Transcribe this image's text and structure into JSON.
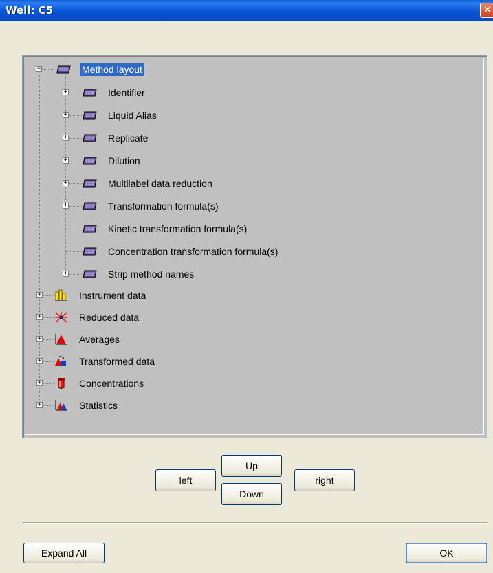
{
  "window": {
    "title": "Well: C5",
    "close_glyph": "✕"
  },
  "tree": {
    "root": {
      "label": "Method layout",
      "icon": "plate-icon"
    },
    "children": [
      {
        "label": "Identifier",
        "expandable": true
      },
      {
        "label": "Liquid Alias",
        "expandable": true
      },
      {
        "label": "Replicate",
        "expandable": true
      },
      {
        "label": "Dilution",
        "expandable": true
      },
      {
        "label": "Multilabel data reduction",
        "expandable": true
      },
      {
        "label": "Transformation formula(s)",
        "expandable": true
      },
      {
        "label": "Kinetic transformation formula(s)",
        "expandable": false
      },
      {
        "label": "Concentration transformation formula(s)",
        "expandable": false
      },
      {
        "label": "Strip method names",
        "expandable": true
      }
    ],
    "top_items": [
      {
        "label": "Instrument data",
        "icon": "bar-chart-icon"
      },
      {
        "label": "Reduced data",
        "icon": "burst-icon"
      },
      {
        "label": "Averages",
        "icon": "peak-icon"
      },
      {
        "label": "Transformed data",
        "icon": "shapes-icon"
      },
      {
        "label": "Concentrations",
        "icon": "beaker-icon"
      },
      {
        "label": "Statistics",
        "icon": "distribution-icon"
      }
    ]
  },
  "nav": {
    "left": "left",
    "up": "Up",
    "down": "Down",
    "right": "right"
  },
  "footer": {
    "expand_all": "Expand All",
    "ok": "OK"
  },
  "colors": {
    "selection": "#316ac5",
    "titlebar": "#0a5fd7",
    "tree_bg": "#c0c0c0"
  }
}
